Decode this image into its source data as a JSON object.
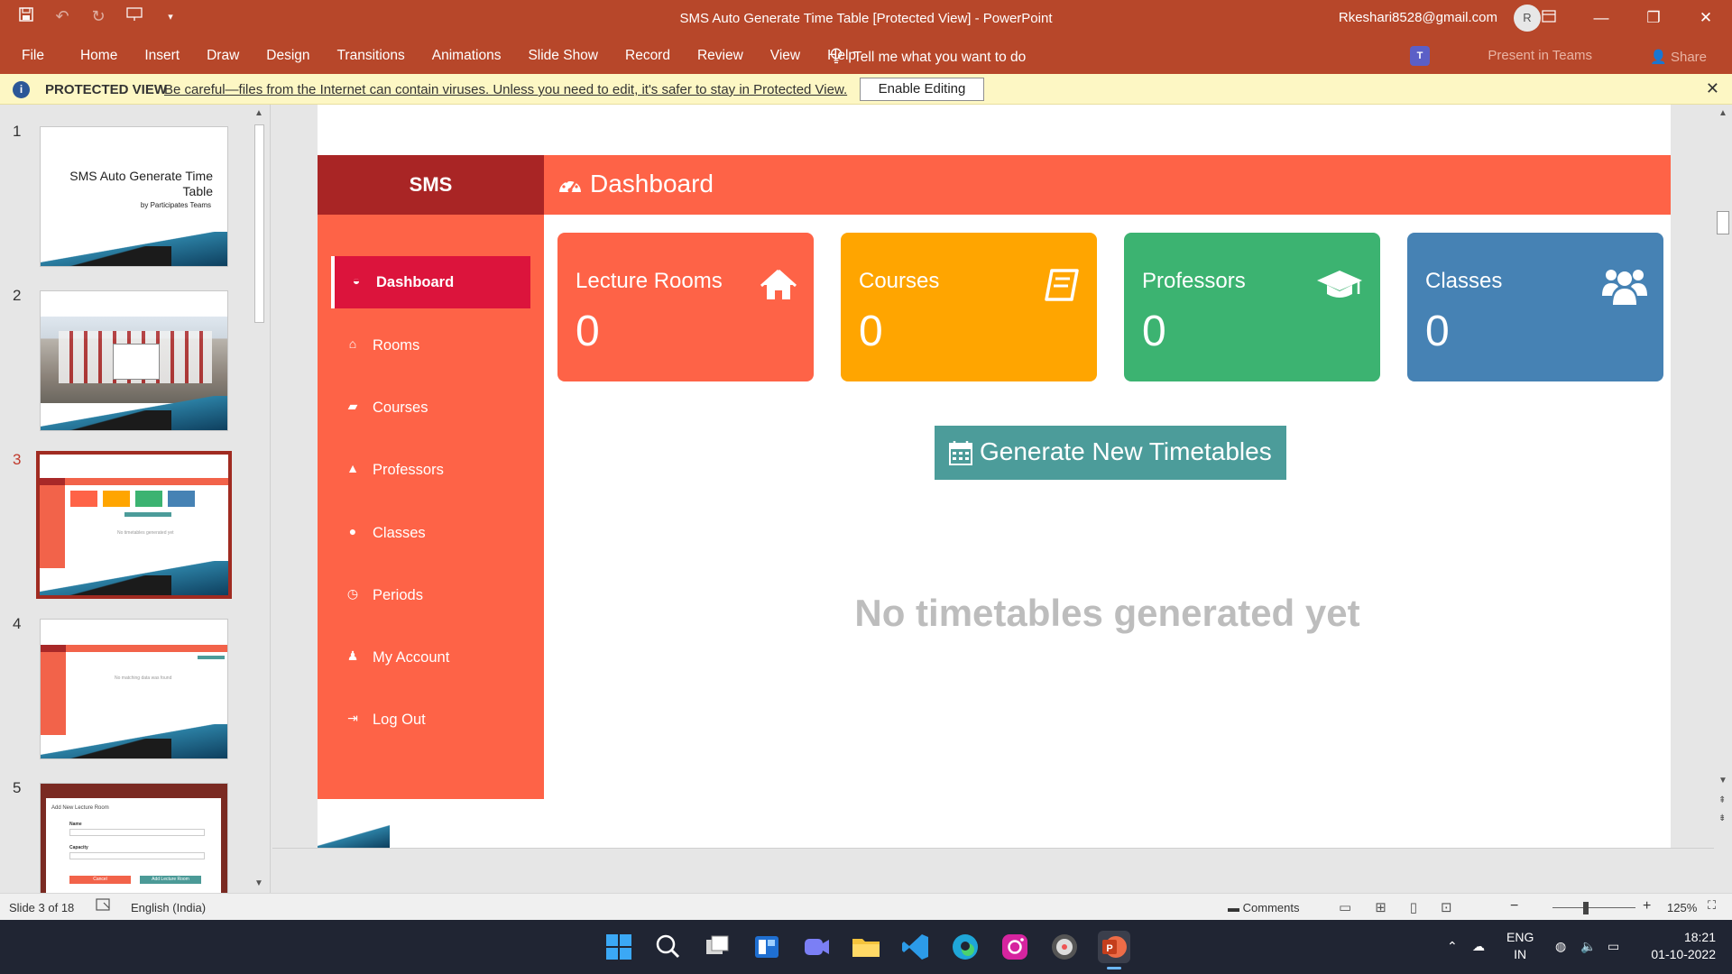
{
  "window": {
    "title": "SMS Auto Generate Time Table [Protected View]  -  PowerPoint",
    "account": "Rkeshari8528@gmail.com",
    "avatar_initial": "R"
  },
  "ribbon": {
    "tabs": [
      "File",
      "Home",
      "Insert",
      "Draw",
      "Design",
      "Transitions",
      "Animations",
      "Slide Show",
      "Record",
      "Review",
      "View",
      "Help"
    ],
    "tell_me": "Tell me what you want to do",
    "present_in_teams": "Present in Teams",
    "share": "Share"
  },
  "protected_view": {
    "title": "PROTECTED VIEW",
    "message": "Be careful—files from the Internet can contain viruses. Unless you need to edit, it's safer to stay in Protected View.",
    "button": "Enable Editing"
  },
  "thumbnails": {
    "numbers": [
      "1",
      "2",
      "3",
      "4",
      "5"
    ],
    "active_index": 3,
    "slide1_title": "SMS Auto Generate Time Table",
    "slide1_subtitle": "by Participates Teams",
    "slide3_empty_text": "No timetables generated yet",
    "slide4_empty_text": "No matching data was found",
    "slide5_title": "Add New Lecture Room",
    "slide5_name": "Name",
    "slide5_capacity": "Capacity",
    "slide5_cancel": "Cancel",
    "slide5_add": "Add Lecture Room"
  },
  "app": {
    "brand": "SMS",
    "page_title": "Dashboard",
    "nav": [
      {
        "label": "Dashboard",
        "icon": "dashboard-icon"
      },
      {
        "label": "Rooms",
        "icon": "home-icon"
      },
      {
        "label": "Courses",
        "icon": "book-icon"
      },
      {
        "label": "Professors",
        "icon": "graduation-cap-icon"
      },
      {
        "label": "Classes",
        "icon": "users-icon"
      },
      {
        "label": "Periods",
        "icon": "clock-icon"
      },
      {
        "label": "My Account",
        "icon": "user-icon"
      },
      {
        "label": "Log Out",
        "icon": "logout-icon"
      }
    ],
    "cards": [
      {
        "title": "Lecture Rooms",
        "value": "0",
        "color": "#fe6347",
        "icon": "home-icon"
      },
      {
        "title": "Courses",
        "value": "0",
        "color": "#ffa500",
        "icon": "book-icon"
      },
      {
        "title": "Professors",
        "value": "0",
        "color": "#3cb371",
        "icon": "graduation-cap-icon"
      },
      {
        "title": "Classes",
        "value": "0",
        "color": "#4682b4",
        "icon": "users-icon"
      }
    ],
    "generate_button": "Generate New Timetables",
    "empty_message": "No timetables generated yet"
  },
  "statusbar": {
    "slide_info": "Slide 3 of 18",
    "language": "English (India)",
    "comments": "Comments",
    "zoom": "125%"
  },
  "taskbar": {
    "lang_top": "ENG",
    "lang_bottom": "IN",
    "time": "18:21",
    "date": "01-10-2022"
  },
  "colors": {
    "powerpoint_red": "#b7472a",
    "sidebar": "#fe6347",
    "brand_bg": "#a92525",
    "active_nav": "#dc143c",
    "generate_button": "#4c9c9a"
  }
}
